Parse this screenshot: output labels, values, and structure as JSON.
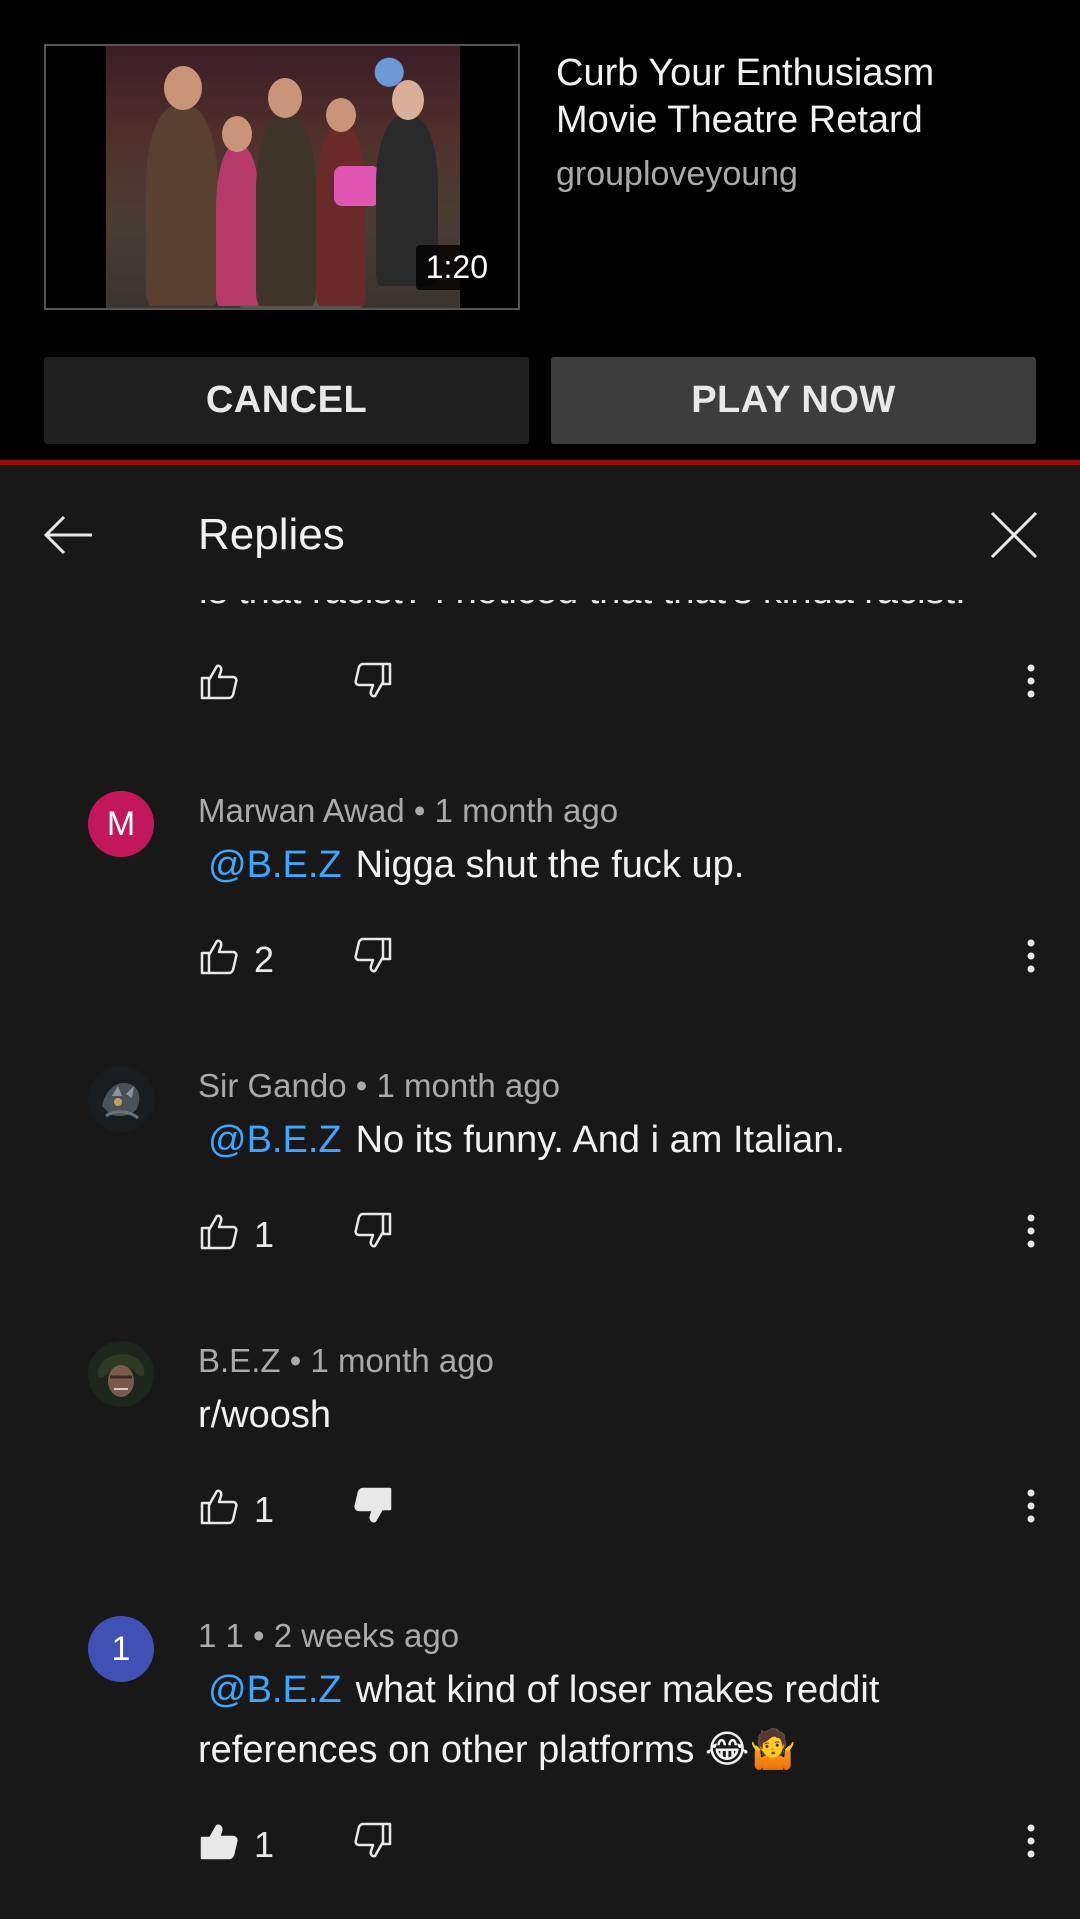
{
  "up_next": {
    "title_line1": "Curb Your Enthusiasm",
    "title_line2": "Movie Theatre Retard",
    "channel": "grouploveyoung",
    "duration": "1:20",
    "cancel_label": "CANCEL",
    "play_label": "PLAY NOW"
  },
  "panel": {
    "title": "Replies",
    "partial_text": "Is that racist? I noticed that that's kinda racist."
  },
  "replies": [
    {
      "author": "Marwan Awad",
      "time": "1 month ago",
      "avatar_letter": "M",
      "avatar_color": "#c2185b",
      "mention": "@B.E.Z",
      "text": "Nigga shut the fuck up.",
      "likes": "2"
    },
    {
      "author": "Sir Gando",
      "time": "1 month ago",
      "avatar_letter": "",
      "avatar_color": "#2a2f33",
      "mention": "@B.E.Z",
      "text": "No its funny. And i am Italian.",
      "likes": "1"
    },
    {
      "author": "B.E.Z",
      "time": "1 month ago",
      "avatar_letter": "",
      "avatar_color": "#1f2a1f",
      "mention": "",
      "text": "r/woosh",
      "likes": "1"
    },
    {
      "author": "1 1",
      "time": "2 weeks ago",
      "avatar_letter": "1",
      "avatar_color": "#3f51b5",
      "mention": "@B.E.Z",
      "text_line1": "what kind of loser makes reddit",
      "text_line2": "references on other platforms",
      "emojis": "😂🤷",
      "likes": "1"
    }
  ],
  "colors": {
    "accent_link": "#3ea6ff",
    "progress_red": "#9a0e0e",
    "background": "#181818"
  }
}
